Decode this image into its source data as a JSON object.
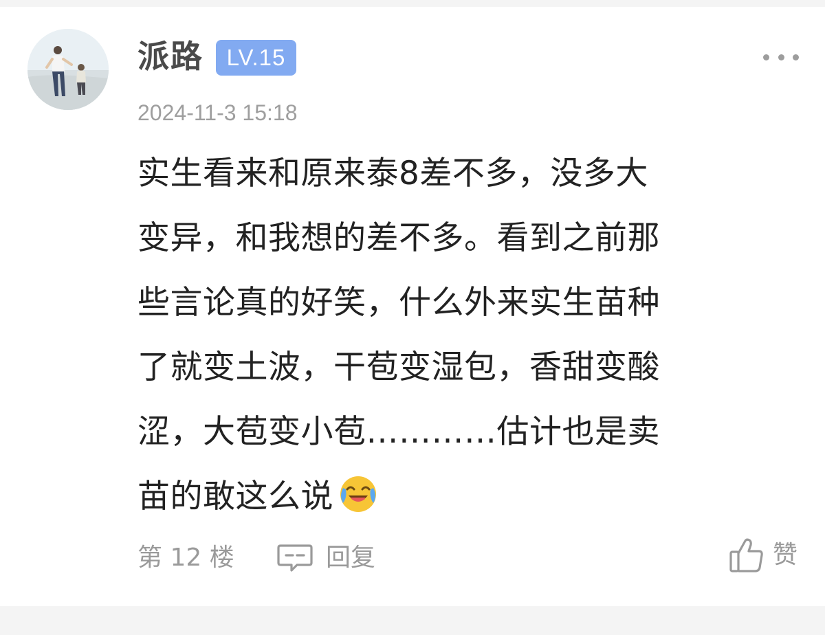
{
  "comment": {
    "author": {
      "name": "派路",
      "level": "LV.15"
    },
    "timestamp": "2024-11-3 15:18",
    "body_lines": [
      "实生看来和原来泰8差不多，没多大",
      "变异，和我想的差不多。看到之前那",
      "些言论真的好笑，什么外来实生苗种",
      "了就变土波，干苞变湿包，香甜变酸",
      "涩，大苞变小苞…………估计也是卖",
      "苗的敢这么说"
    ],
    "emoji": "crying-laughing-emoji",
    "footer": {
      "floor": "第 12 楼",
      "reply": "回复",
      "like": "赞"
    }
  },
  "colors": {
    "badge": "#82aaf1",
    "text_primary": "#222222",
    "text_secondary": "#9a9a9a",
    "username": "#4a4a4a"
  }
}
